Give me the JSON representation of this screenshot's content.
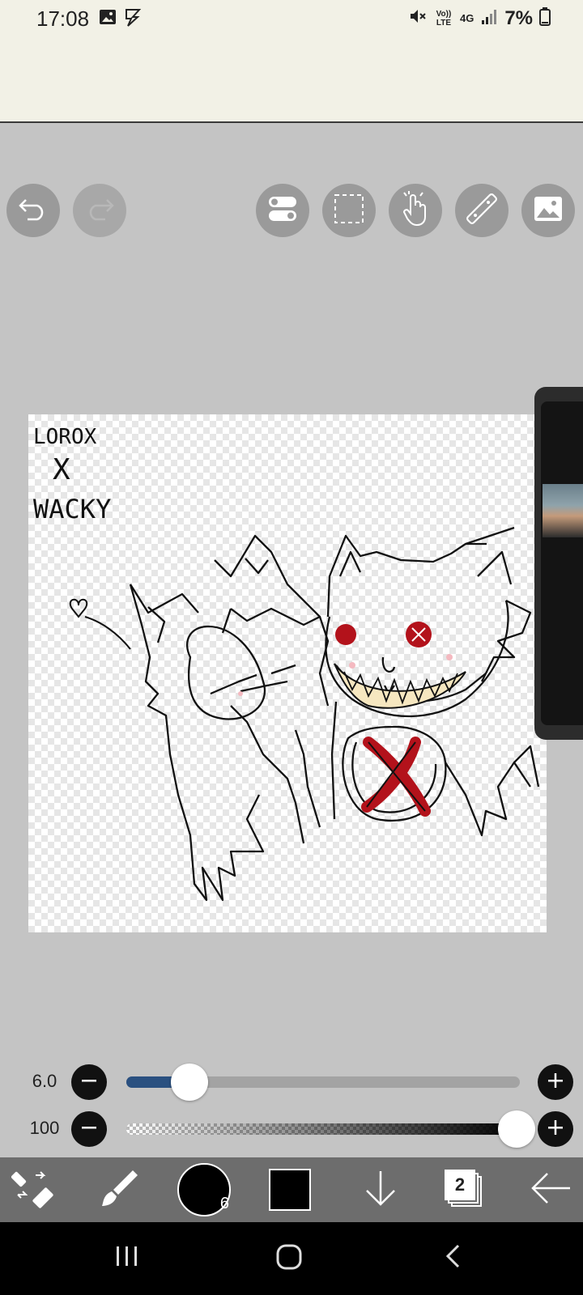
{
  "status_bar": {
    "time": "17:08",
    "network_top": "Vo)) LTE",
    "network_gen": "4G",
    "battery": "7%",
    "icons": [
      "image-icon",
      "flash-icon",
      "mute-icon",
      "signal-icon",
      "battery-icon"
    ]
  },
  "toolbar_top": {
    "buttons": [
      "undo-icon",
      "redo-icon",
      "toggle-icon",
      "selection-icon",
      "hand-icon",
      "ruler-icon",
      "image-icon"
    ]
  },
  "artwork": {
    "text_line1": "LOROX",
    "text_line2": "X",
    "text_line3": "WACKY",
    "accent_red": "#b3121b",
    "teeth_color": "#f6e7c0"
  },
  "brush": {
    "size_value": "6.0",
    "size_fraction": 0.12,
    "opacity_value": "100",
    "opacity_fraction": 1.0,
    "track_fill_color": "#2a5080"
  },
  "bottom_toolbar": {
    "brush_size_badge": "6",
    "layers_count": "2",
    "primary_color": "#000000"
  },
  "colors": {
    "statusbar_bg": "#f2f1e6",
    "canvas_bg": "#c4c4c4",
    "bottombar_bg": "#6d6d6d"
  }
}
